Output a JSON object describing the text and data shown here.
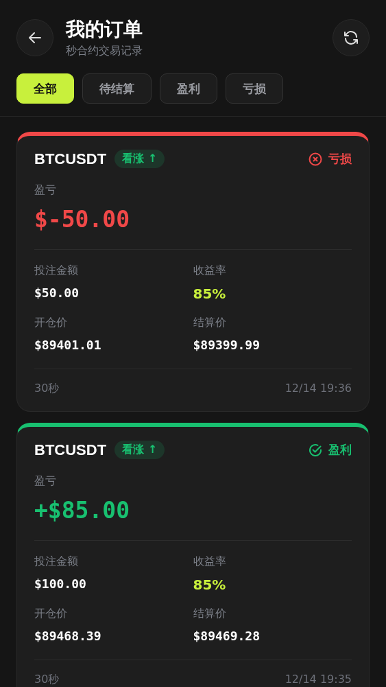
{
  "header": {
    "title": "我的订单",
    "subtitle": "秒合约交易记录"
  },
  "tabs": [
    {
      "label": "全部",
      "selected": true
    },
    {
      "label": "待结算",
      "selected": false
    },
    {
      "label": "盈利",
      "selected": false
    },
    {
      "label": "亏损",
      "selected": false
    }
  ],
  "orders": [
    {
      "symbol": "BTCUSDT",
      "direction": {
        "label": "看涨 ↑",
        "kind": "up"
      },
      "result": {
        "label": "亏损",
        "kind": "loss"
      },
      "pnl_label": "盈亏",
      "pnl": "$-50.00",
      "fields": [
        {
          "label": "投注金额",
          "value": "$50.00",
          "kind": "plain"
        },
        {
          "label": "收益率",
          "value": "85%",
          "kind": "rate"
        },
        {
          "label": "开仓价",
          "value": "$89401.01",
          "kind": "plain"
        },
        {
          "label": "结算价",
          "value": "$89399.99",
          "kind": "plain"
        }
      ],
      "duration": "30秒",
      "time": "12/14 19:36"
    },
    {
      "symbol": "BTCUSDT",
      "direction": {
        "label": "看涨 ↑",
        "kind": "up"
      },
      "result": {
        "label": "盈利",
        "kind": "win"
      },
      "pnl_label": "盈亏",
      "pnl": "+$85.00",
      "fields": [
        {
          "label": "投注金额",
          "value": "$100.00",
          "kind": "plain"
        },
        {
          "label": "收益率",
          "value": "85%",
          "kind": "rate"
        },
        {
          "label": "开仓价",
          "value": "$89468.39",
          "kind": "plain"
        },
        {
          "label": "结算价",
          "value": "$89469.28",
          "kind": "plain"
        }
      ],
      "duration": "30秒",
      "time": "12/14 19:35"
    }
  ]
}
